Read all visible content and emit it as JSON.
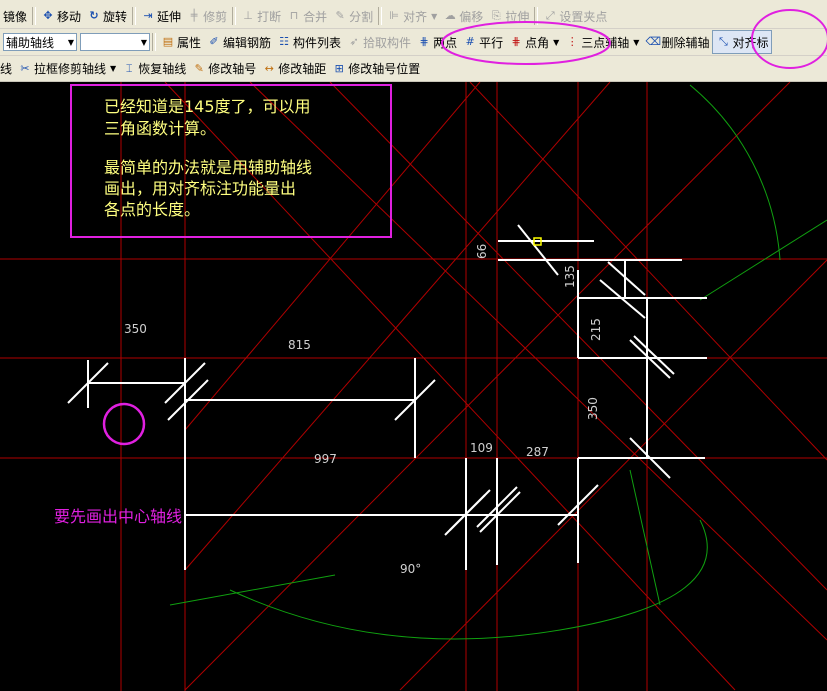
{
  "toolbar1": {
    "mirror": "镜像",
    "move": "移动",
    "rotate": "旋转",
    "extend": "延伸",
    "trim": "修剪",
    "break": "打断",
    "merge": "合并",
    "split": "分割",
    "align": "对齐",
    "offset": "偏移",
    "stretch": "拉伸",
    "grip": "设置夹点"
  },
  "toolbar2": {
    "layer_combo": "辅助轴线",
    "second_combo": "",
    "properties": "属性",
    "edit_rebar": "编辑钢筋",
    "component_list": "构件列表",
    "pick_component": "拾取构件",
    "two_point": "两点",
    "parallel": "平行",
    "point_angle": "点角",
    "three_point_axis": "三点辅轴",
    "delete_axis": "删除辅轴",
    "align_dim": "对齐标"
  },
  "toolbar3": {
    "axis_tail": "线",
    "box_trim_axis": "拉框修剪轴线",
    "restore_axis": "恢复轴线",
    "modify_axis_no": "修改轴号",
    "modify_axis_dist": "修改轴距",
    "modify_axis_pos": "修改轴号位置"
  },
  "canvas": {
    "note_lines": [
      "已经知道是145度了，可以用",
      "三角函数计算。",
      "",
      "最简单的办法就是用辅助轴线",
      "画出，用对齐标注功能量出",
      "各点的长度。"
    ],
    "center_note": "要先画出中心轴线",
    "dims": {
      "d350_top": "350",
      "d815": "815",
      "d997": "997",
      "d109": "109",
      "d287": "287",
      "d66": "66",
      "d135": "135",
      "d215": "215",
      "d350_right": "350",
      "d90": "90°"
    }
  },
  "colors": {
    "annotation": "#e020e0",
    "note_text": "#ffff80",
    "axis_red": "#b00000",
    "arc_green": "#10a010",
    "line_white": "#ffffff"
  }
}
